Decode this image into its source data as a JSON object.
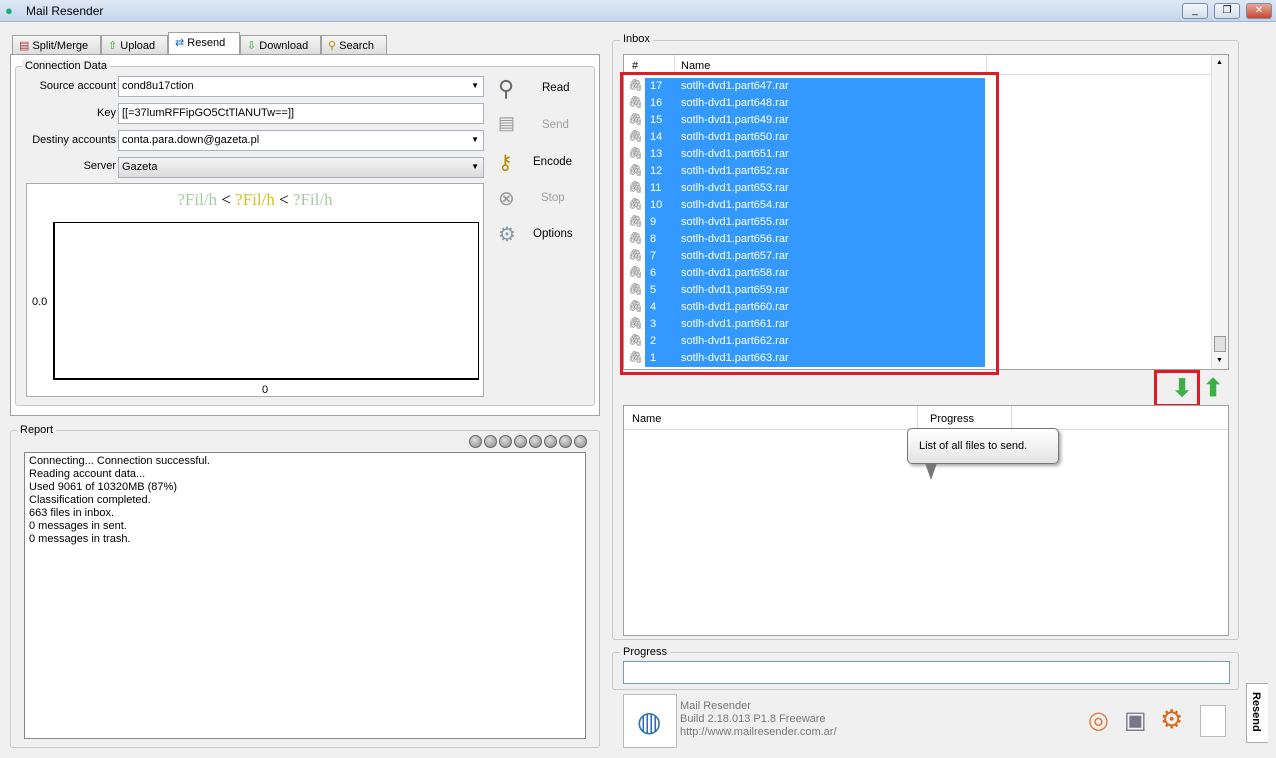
{
  "window": {
    "title": "Mail Resender",
    "controls": [
      "minimize",
      "restore",
      "close"
    ]
  },
  "tabs": [
    {
      "label": "Split/Merge",
      "icon": "split-merge-icon"
    },
    {
      "label": "Upload",
      "icon": "upload-arrow-icon"
    },
    {
      "label": "Resend",
      "icon": "resend-arrows-icon",
      "active": true
    },
    {
      "label": "Download",
      "icon": "download-arrow-icon"
    },
    {
      "label": "Search",
      "icon": "search-icon"
    }
  ],
  "connection": {
    "legend": "Connection Data",
    "source_label": "Source account",
    "source_value": "cond8u17ction",
    "key_label": "Key",
    "key_value": "[[=37lumRFFipGO5CtTlANUTw==]]",
    "destiny_label": "Destiny accounts",
    "destiny_value": "conta.para.down@gazeta.pl",
    "server_label": "Server",
    "server_value": "Gazeta"
  },
  "speed": {
    "left": "?Fil/h",
    "lt1": "<",
    "mid": "?Fil/h",
    "lt2": "<",
    "right": "?Fil/h",
    "y_tick": "0.0",
    "x_tick": "0"
  },
  "actions": {
    "read": "Read",
    "send": "Send",
    "encode": "Encode",
    "stop": "Stop",
    "options": "Options"
  },
  "report": {
    "legend": "Report",
    "lines": [
      "Connecting... Connection successful.",
      "Reading account data...",
      "Used 9061 of 10320MB (87%)",
      "Classification completed.",
      "663 files in inbox.",
      "0 messages in sent.",
      "0 messages in trash."
    ],
    "indicator_count": 8
  },
  "inbox": {
    "legend": "Inbox",
    "col_num": "#",
    "col_name": "Name",
    "rows": [
      {
        "n": "17",
        "name": "sotlh-dvd1.part647.rar"
      },
      {
        "n": "16",
        "name": "sotlh-dvd1.part648.rar"
      },
      {
        "n": "15",
        "name": "sotlh-dvd1.part649.rar"
      },
      {
        "n": "14",
        "name": "sotlh-dvd1.part650.rar"
      },
      {
        "n": "13",
        "name": "sotlh-dvd1.part651.rar"
      },
      {
        "n": "12",
        "name": "sotlh-dvd1.part652.rar"
      },
      {
        "n": "11",
        "name": "sotlh-dvd1.part653.rar"
      },
      {
        "n": "10",
        "name": "sotlh-dvd1.part654.rar"
      },
      {
        "n": "9",
        "name": "sotlh-dvd1.part655.rar"
      },
      {
        "n": "8",
        "name": "sotlh-dvd1.part656.rar"
      },
      {
        "n": "7",
        "name": "sotlh-dvd1.part657.rar"
      },
      {
        "n": "6",
        "name": "sotlh-dvd1.part658.rar"
      },
      {
        "n": "5",
        "name": "sotlh-dvd1.part659.rar"
      },
      {
        "n": "4",
        "name": "sotlh-dvd1.part660.rar"
      },
      {
        "n": "3",
        "name": "sotlh-dvd1.part661.rar"
      },
      {
        "n": "2",
        "name": "sotlh-dvd1.part662.rar"
      },
      {
        "n": "1",
        "name": "sotlh-dvd1.part663.rar"
      }
    ]
  },
  "send_list": {
    "col_name": "Name",
    "col_progress": "Progress",
    "tooltip": "List of all files to send."
  },
  "progress": {
    "legend": "Progress",
    "value": 0
  },
  "about": {
    "name": "Mail Resender",
    "build": "Build 2.18.013 P1.8 Freeware",
    "url": "http://www.mailresender.com.ar/"
  },
  "side_tab": "Resend",
  "colors": {
    "selection": "#3399ff",
    "highlight_box": "#e01b24",
    "arrow_green": "#3cb043"
  }
}
